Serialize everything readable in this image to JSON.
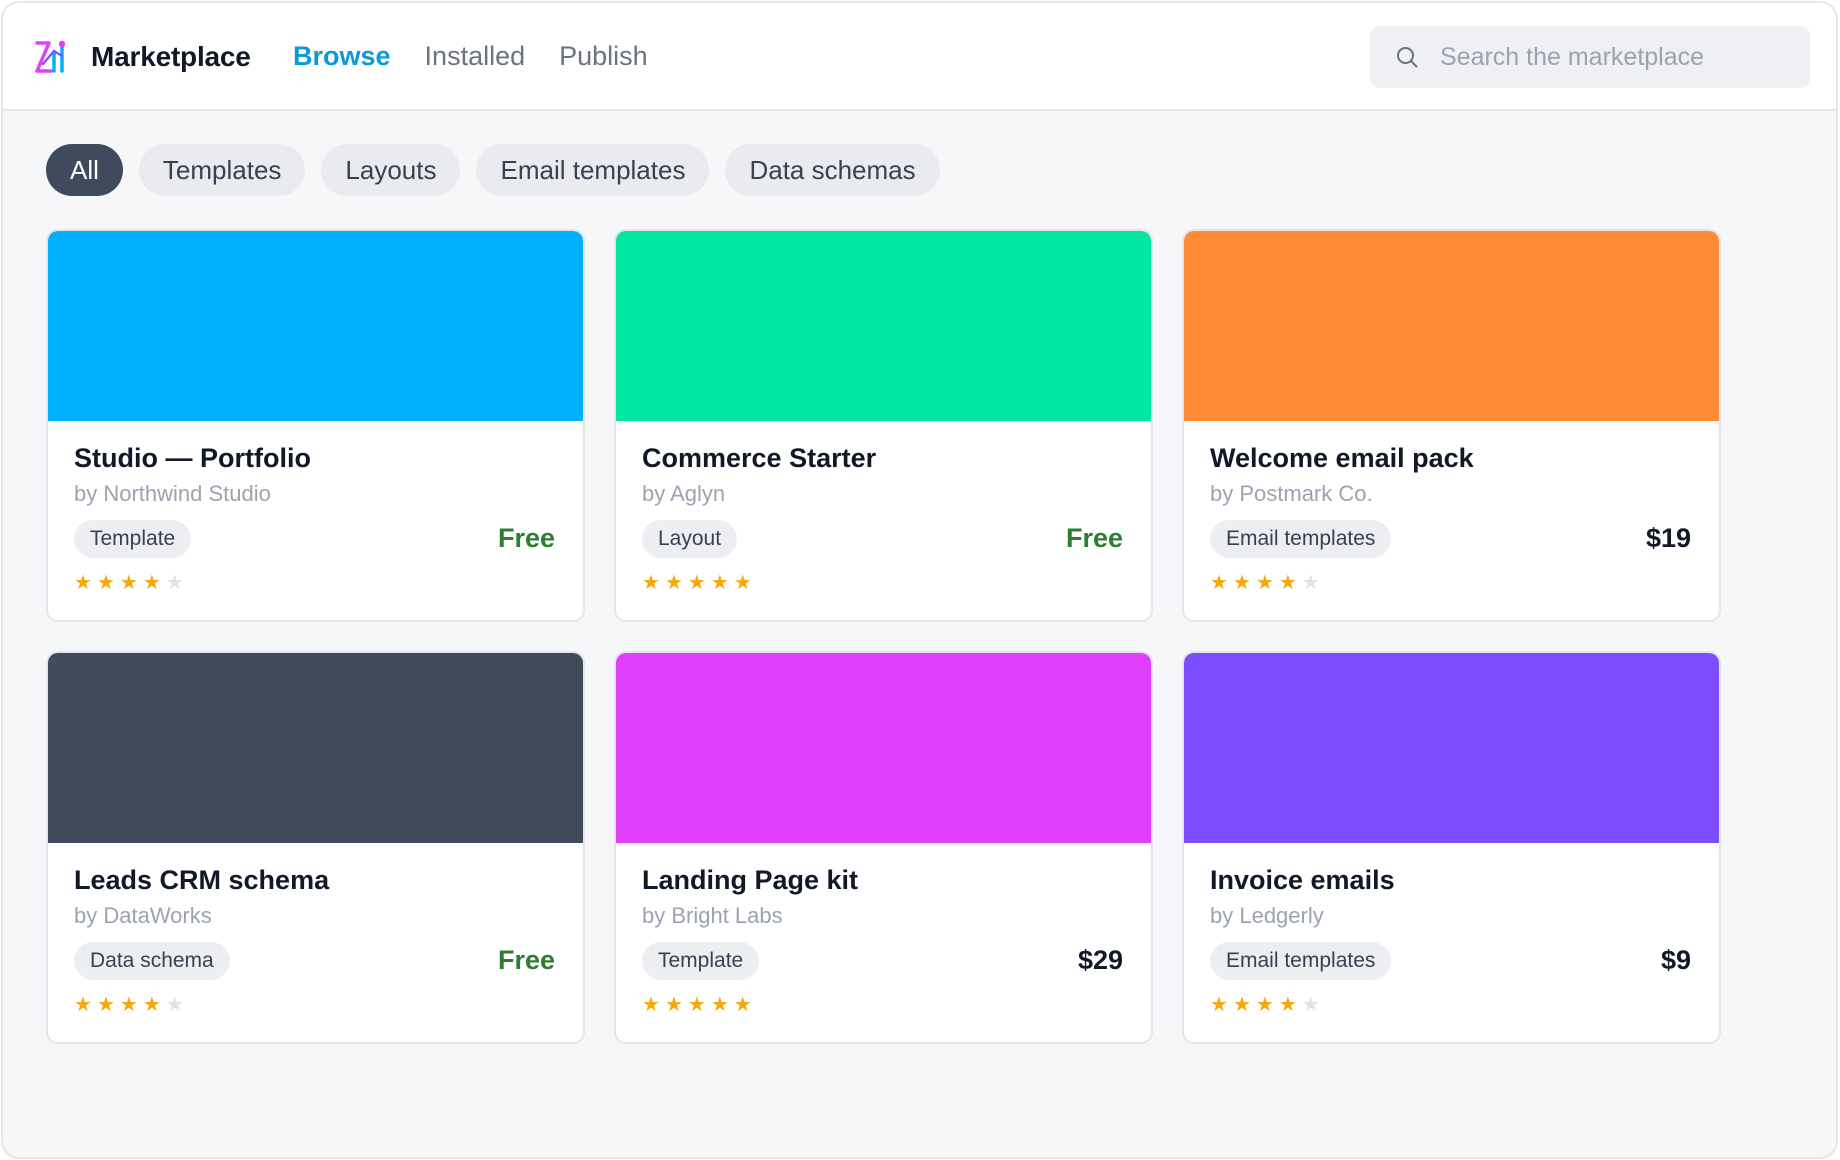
{
  "app": {
    "title": "Marketplace"
  },
  "nav": {
    "tabs": [
      {
        "label": "Browse",
        "active": true
      },
      {
        "label": "Installed",
        "active": false
      },
      {
        "label": "Publish",
        "active": false
      }
    ]
  },
  "search": {
    "placeholder": "Search the marketplace",
    "value": ""
  },
  "filters": [
    {
      "label": "All",
      "active": true
    },
    {
      "label": "Templates",
      "active": false
    },
    {
      "label": "Layouts",
      "active": false
    },
    {
      "label": "Email templates",
      "active": false
    },
    {
      "label": "Data schemas",
      "active": false
    }
  ],
  "cards": [
    {
      "title": "Studio — Portfolio",
      "author": "by Northwind Studio",
      "tag": "Template",
      "price": "Free",
      "rating": 4,
      "cover_color": "#00b0ff"
    },
    {
      "title": "Commerce Starter",
      "author": "by Aglyn",
      "tag": "Layout",
      "price": "Free",
      "rating": 5,
      "cover_color": "#00e5a0"
    },
    {
      "title": "Welcome email pack",
      "author": "by Postmark Co.",
      "tag": "Email templates",
      "price": "$19",
      "rating": 4,
      "cover_color": "#ff8c35"
    },
    {
      "title": "Leads CRM schema",
      "author": "by DataWorks",
      "tag": "Data schema",
      "price": "Free",
      "rating": 4,
      "cover_color": "#404b5b"
    },
    {
      "title": "Landing Page kit",
      "author": "by Bright Labs",
      "tag": "Template",
      "price": "$29",
      "rating": 5,
      "cover_color": "#e040fb"
    },
    {
      "title": "Invoice emails",
      "author": "by Ledgerly",
      "tag": "Email templates",
      "price": "$9",
      "rating": 4,
      "cover_color": "#7c4dff"
    }
  ],
  "colors": {
    "accent": "#0c9ad6",
    "free_price": "#2e7d32",
    "star": "#f5a70b",
    "star_empty": "#dfe3e8",
    "active_chip": "#3f4b5c"
  },
  "icons": {
    "logo": "marketplace-logo-icon",
    "search": "search-icon",
    "star": "star-icon"
  }
}
